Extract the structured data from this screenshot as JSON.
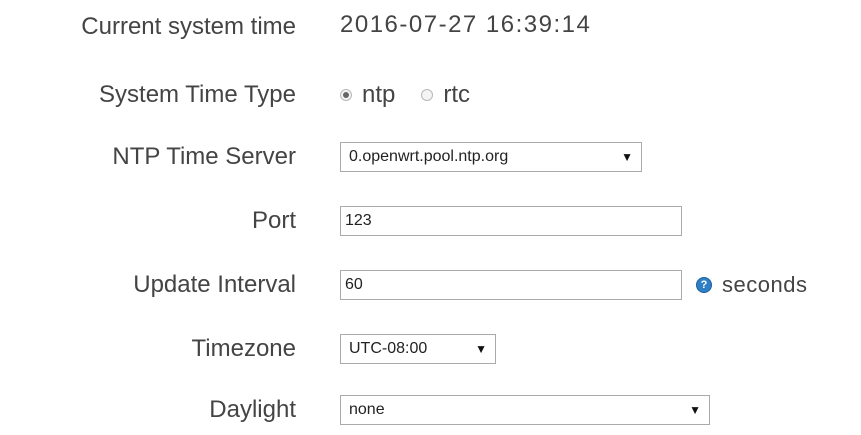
{
  "form": {
    "current_time": {
      "label": "Current system time",
      "value": "2016-07-27 16:39:14"
    },
    "time_type": {
      "label": "System Time Type",
      "options": [
        {
          "label": "ntp",
          "checked": true
        },
        {
          "label": "rtc",
          "checked": false
        }
      ]
    },
    "ntp_server": {
      "label": "NTP Time Server",
      "selected": "0.openwrt.pool.ntp.org"
    },
    "port": {
      "label": "Port",
      "value": "123"
    },
    "update_interval": {
      "label": "Update Interval",
      "value": "60",
      "unit": "seconds",
      "help_icon": "question-icon"
    },
    "timezone": {
      "label": "Timezone",
      "selected": "UTC-08:00"
    },
    "daylight": {
      "label": "Daylight",
      "selected": "none"
    }
  },
  "colors": {
    "text": "#444444",
    "help_icon": "#2f7fc6",
    "input_border": "#aaaaaa"
  }
}
